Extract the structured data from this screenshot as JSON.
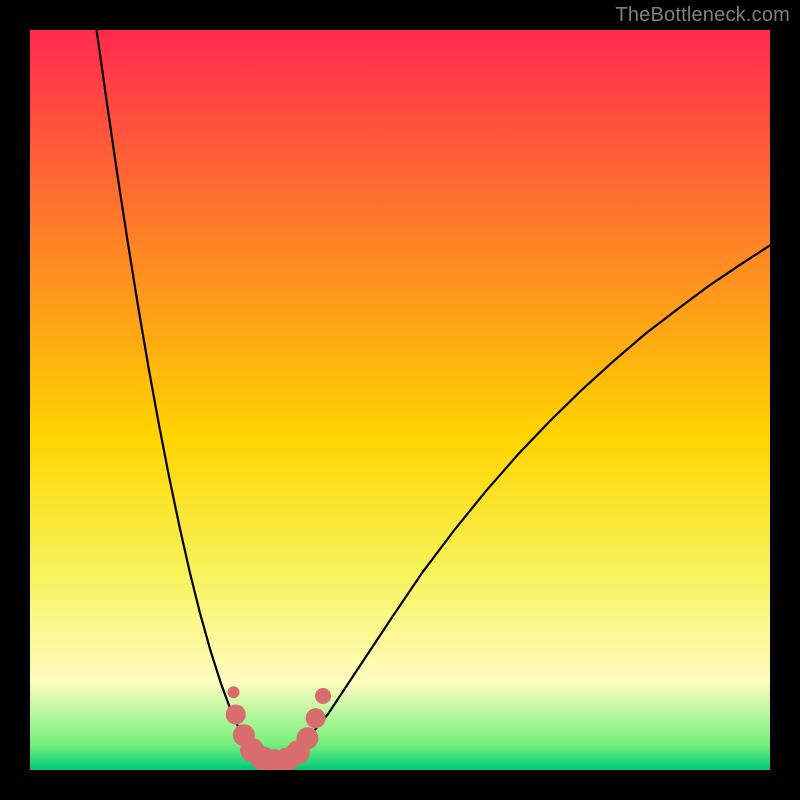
{
  "watermark": "TheBottleneck.com",
  "chart_data": {
    "type": "line",
    "title": "",
    "xlabel": "",
    "ylabel": "",
    "xlim": [
      0,
      1
    ],
    "ylim": [
      0,
      1
    ],
    "valley_x": 0.32,
    "background_gradient": [
      {
        "stop": 0.0,
        "color": "#ff2a4f"
      },
      {
        "stop": 0.55,
        "color": "#ffd400"
      },
      {
        "stop": 0.73,
        "color": "#f7f35a"
      },
      {
        "stop": 0.88,
        "color": "#fffcc0"
      },
      {
        "stop": 0.965,
        "color": "#76f07c"
      },
      {
        "stop": 1.0,
        "color": "#00c87a"
      }
    ],
    "series": [
      {
        "name": "left-curve",
        "x": [
          0.09,
          0.104,
          0.118,
          0.132,
          0.146,
          0.16,
          0.174,
          0.188,
          0.202,
          0.216,
          0.23,
          0.244,
          0.258,
          0.272,
          0.286,
          0.3
        ],
        "y": [
          1.0,
          0.901,
          0.805,
          0.714,
          0.627,
          0.545,
          0.468,
          0.396,
          0.329,
          0.267,
          0.211,
          0.161,
          0.117,
          0.079,
          0.048,
          0.024
        ]
      },
      {
        "name": "right-curve",
        "x": [
          0.36,
          0.403,
          0.446,
          0.489,
          0.531,
          0.574,
          0.617,
          0.66,
          0.703,
          0.746,
          0.789,
          0.831,
          0.874,
          0.917,
          0.96,
          1.0
        ],
        "y": [
          0.024,
          0.076,
          0.141,
          0.206,
          0.268,
          0.325,
          0.378,
          0.427,
          0.472,
          0.514,
          0.553,
          0.589,
          0.622,
          0.654,
          0.683,
          0.709
        ]
      },
      {
        "name": "valley-floor",
        "x": [
          0.295,
          0.31,
          0.33,
          0.35,
          0.37
        ],
        "y": [
          0.02,
          0.01,
          0.01,
          0.01,
          0.024
        ]
      }
    ],
    "markers": {
      "name": "valley-markers",
      "color": "#d96d6d",
      "points": [
        {
          "x": 0.275,
          "y": 0.105,
          "r": 6
        },
        {
          "x": 0.278,
          "y": 0.075,
          "r": 10
        },
        {
          "x": 0.289,
          "y": 0.047,
          "r": 11
        },
        {
          "x": 0.3,
          "y": 0.027,
          "r": 12
        },
        {
          "x": 0.314,
          "y": 0.016,
          "r": 12
        },
        {
          "x": 0.33,
          "y": 0.012,
          "r": 12
        },
        {
          "x": 0.347,
          "y": 0.014,
          "r": 12
        },
        {
          "x": 0.362,
          "y": 0.024,
          "r": 12
        },
        {
          "x": 0.375,
          "y": 0.043,
          "r": 11
        },
        {
          "x": 0.386,
          "y": 0.07,
          "r": 10
        },
        {
          "x": 0.396,
          "y": 0.1,
          "r": 8
        }
      ]
    }
  }
}
